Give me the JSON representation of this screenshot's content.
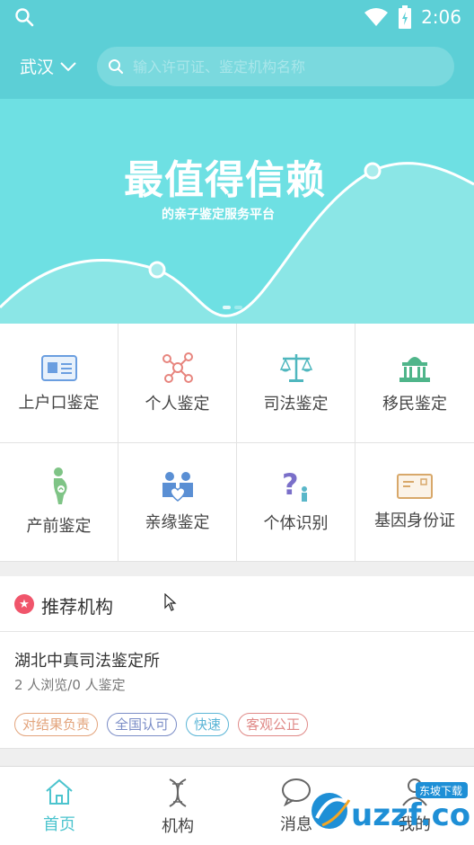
{
  "status_bar": {
    "time": "2:06"
  },
  "header": {
    "city": "武汉",
    "search_placeholder": "输入许可证、鉴定机构名称"
  },
  "banner": {
    "title": "最值得信赖",
    "subtitle": "的亲子鉴定服务平台"
  },
  "categories": [
    {
      "label": "上户口鉴定",
      "icon": "id-card-icon"
    },
    {
      "label": "个人鉴定",
      "icon": "molecule-icon"
    },
    {
      "label": "司法鉴定",
      "icon": "scales-icon"
    },
    {
      "label": "移民鉴定",
      "icon": "government-building-icon"
    },
    {
      "label": "产前鉴定",
      "icon": "pregnant-icon"
    },
    {
      "label": "亲缘鉴定",
      "icon": "couple-icon"
    },
    {
      "label": "个体识别",
      "icon": "question-person-icon"
    },
    {
      "label": "基因身份证",
      "icon": "card-icon"
    }
  ],
  "recommended": {
    "title": "推荐机构",
    "org": {
      "name": "湖北中真司法鉴定所",
      "stats": "2 人浏览/0 人鉴定",
      "tags": [
        {
          "text": "对结果负责",
          "color": "#e3a47c"
        },
        {
          "text": "全国认可",
          "color": "#7a8cc6"
        },
        {
          "text": "快速",
          "color": "#5bb5d6"
        },
        {
          "text": "客观公正",
          "color": "#e08a88"
        }
      ]
    }
  },
  "tabbar": [
    {
      "label": "首页",
      "icon": "home-icon",
      "active": true
    },
    {
      "label": "机构",
      "icon": "dna-icon",
      "active": false
    },
    {
      "label": "消息",
      "icon": "chat-bubble-icon",
      "active": false
    },
    {
      "label": "我的",
      "icon": "person-icon",
      "active": false
    }
  ],
  "watermark": {
    "text": "东坡下载",
    "brand": "uzzf.com"
  },
  "colors": {
    "primary": "#5ccfd6",
    "accent": "#4cc4ce",
    "badge": "#f0556b"
  }
}
